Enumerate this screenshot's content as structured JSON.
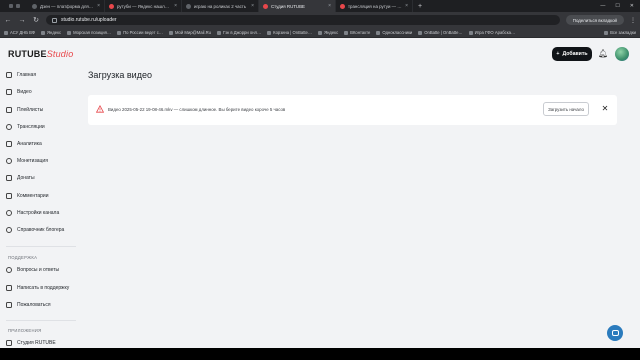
{
  "browser": {
    "tabs": [
      {
        "title": "Дзен — платформа для прос…",
        "active": false
      },
      {
        "title": "рутуби — Яндекс нашлось 2…",
        "active": false
      },
      {
        "title": "играю на роликах 2 часть",
        "active": false
      },
      {
        "title": "Студия RUTUBE",
        "active": true
      },
      {
        "title": "трансляция на рутуи — Янд…",
        "active": false
      }
    ],
    "new_tab": "+",
    "address": "studio.rutube.ru/uploader",
    "share_label": "Поделиться вкладкой",
    "bookmarks": [
      "АСУ ДНБ ВФ",
      "Яндекс",
      "Морская позиция…",
      "По России ведет с…",
      "Мой Мир@Mail.Ru",
      "Гэк в Джорри онл…",
      "Корзина | OnBatte…",
      "Яндекс",
      "ВКонтакте",
      "Одноклассники",
      "OnBatte | OnBatte…",
      "Игра ГФО Арабска…"
    ],
    "all_bookmarks": "Все закладки"
  },
  "header": {
    "logo_main": "RUTUBE",
    "logo_studio": "Studio",
    "add_button": "Добавить",
    "colors": {
      "brand": "#e8474b",
      "primary_button": "#111418"
    }
  },
  "sidebar": {
    "items": [
      {
        "label": "Главная",
        "icon": "home-icon"
      },
      {
        "label": "Видео",
        "icon": "video-icon"
      },
      {
        "label": "Плейлисты",
        "icon": "playlist-icon"
      },
      {
        "label": "Трансляции",
        "icon": "broadcast-icon"
      },
      {
        "label": "Аналитика",
        "icon": "analytics-icon"
      },
      {
        "label": "Монетизация",
        "icon": "monetization-icon"
      },
      {
        "label": "Донаты",
        "icon": "donate-icon"
      },
      {
        "label": "Комментарии",
        "icon": "comments-icon"
      },
      {
        "label": "Настройки канала",
        "icon": "settings-icon"
      },
      {
        "label": "Справочник блогера",
        "icon": "handbook-icon"
      }
    ],
    "support_title": "ПОДДЕРЖКА",
    "support_items": [
      {
        "label": "Вопросы и ответы",
        "icon": "faq-icon"
      },
      {
        "label": "Написать в поддержку",
        "icon": "mail-icon"
      },
      {
        "label": "Пожаловаться",
        "icon": "report-icon"
      }
    ],
    "apps_title": "ПРИЛОЖЕНИЯ",
    "apps_items": [
      {
        "label": "Студия RUTUBE",
        "icon": "app-icon"
      }
    ]
  },
  "main": {
    "title": "Загрузка видео",
    "upload_error": {
      "message": "Видео 2025-05-22 19-08-46.mkv — слишком длинное. Вы берите видео короче 5 часов",
      "retry_button": "Загрузить начало"
    }
  }
}
